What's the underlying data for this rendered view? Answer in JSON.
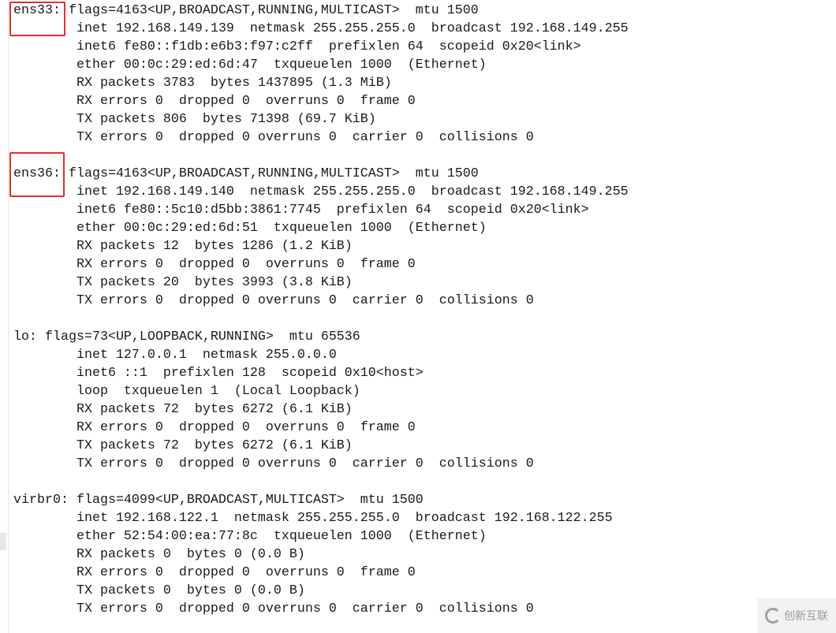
{
  "terminal": {
    "lines": [
      "ens33: flags=4163<UP,BROADCAST,RUNNING,MULTICAST>  mtu 1500",
      "        inet 192.168.149.139  netmask 255.255.255.0  broadcast 192.168.149.255",
      "        inet6 fe80::f1db:e6b3:f97:c2ff  prefixlen 64  scopeid 0x20<link>",
      "        ether 00:0c:29:ed:6d:47  txqueuelen 1000  (Ethernet)",
      "        RX packets 3783  bytes 1437895 (1.3 MiB)",
      "        RX errors 0  dropped 0  overruns 0  frame 0",
      "        TX packets 806  bytes 71398 (69.7 KiB)",
      "        TX errors 0  dropped 0 overruns 0  carrier 0  collisions 0",
      "",
      "ens36: flags=4163<UP,BROADCAST,RUNNING,MULTICAST>  mtu 1500",
      "        inet 192.168.149.140  netmask 255.255.255.0  broadcast 192.168.149.255",
      "        inet6 fe80::5c10:d5bb:3861:7745  prefixlen 64  scopeid 0x20<link>",
      "        ether 00:0c:29:ed:6d:51  txqueuelen 1000  (Ethernet)",
      "        RX packets 12  bytes 1286 (1.2 KiB)",
      "        RX errors 0  dropped 0  overruns 0  frame 0",
      "        TX packets 20  bytes 3993 (3.8 KiB)",
      "        TX errors 0  dropped 0 overruns 0  carrier 0  collisions 0",
      "",
      "lo: flags=73<UP,LOOPBACK,RUNNING>  mtu 65536",
      "        inet 127.0.0.1  netmask 255.0.0.0",
      "        inet6 ::1  prefixlen 128  scopeid 0x10<host>",
      "        loop  txqueuelen 1  (Local Loopback)",
      "        RX packets 72  bytes 6272 (6.1 KiB)",
      "        RX errors 0  dropped 0  overruns 0  frame 0",
      "        TX packets 72  bytes 6272 (6.1 KiB)",
      "        TX errors 0  dropped 0 overruns 0  carrier 0  collisions 0",
      "",
      "virbr0: flags=4099<UP,BROADCAST,MULTICAST>  mtu 1500",
      "        inet 192.168.122.1  netmask 255.255.255.0  broadcast 192.168.122.255",
      "        ether 52:54:00:ea:77:8c  txqueuelen 1000  (Ethernet)",
      "        RX packets 0  bytes 0 (0.0 B)",
      "        RX errors 0  dropped 0  overruns 0  frame 0",
      "        TX packets 0  bytes 0 (0.0 B)",
      "        TX errors 0  dropped 0 overruns 0  carrier 0  collisions 0"
    ]
  },
  "highlight_color": "#e0302c",
  "watermark": {
    "text": "创新互联"
  }
}
